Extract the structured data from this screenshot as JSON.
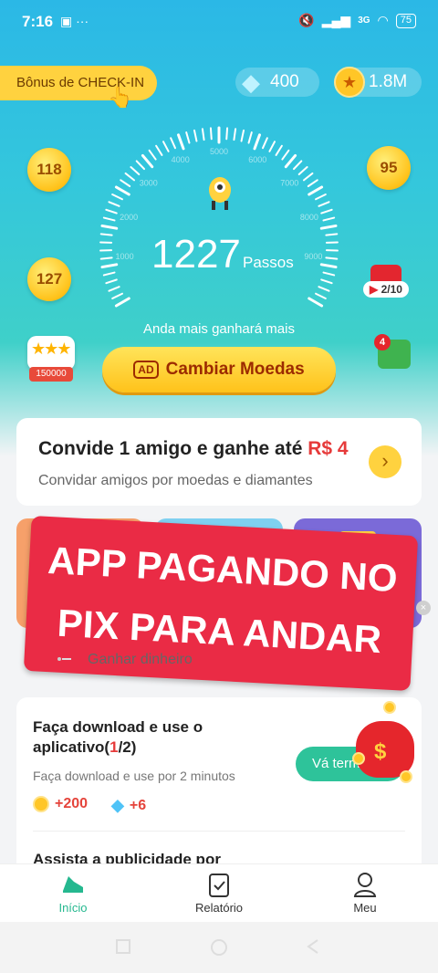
{
  "status_bar": {
    "time": "7:16",
    "left_icons": "▣ ···",
    "network": "3G",
    "battery": "75"
  },
  "header": {
    "checkin_label": "Bônus de CHECK-IN",
    "diamonds": "400",
    "coins": "1.8M"
  },
  "bubbles": {
    "top_left": "118",
    "bottom_left": "127",
    "top_right": "95"
  },
  "gauge": {
    "ticks": [
      "1000",
      "2000",
      "3000",
      "4000",
      "5000",
      "6000",
      "7000",
      "8000",
      "9000"
    ],
    "steps": "1227",
    "steps_unit": "Passos",
    "tagline": "Anda mais ganhará mais"
  },
  "gift": {
    "progress": "2/10"
  },
  "chest": {
    "label": "150000"
  },
  "money": {
    "badge": "4"
  },
  "exchange_button": {
    "ad_label": "AD",
    "label": "Cambiar Moedas"
  },
  "invite": {
    "title": "Convide 1 amigo e ganhe até ",
    "amount": "R$ 4",
    "subtitle": "Convidar amigos por moedas e diamantes",
    "arrow": "›"
  },
  "banner": {
    "line1": "APP PAGANDO NO",
    "line2": "PIX PARA ANDAR",
    "close": "×"
  },
  "earn_text": "Ganhar dinheiro",
  "task": {
    "title": "Faça download e use o aplicativo(",
    "progress": "1",
    "progress_suffix": "/2)",
    "subtitle": "Faça download e use por 2 minutos",
    "reward_coins": "+200",
    "reward_diamonds": "+6",
    "button": "Vá terminar",
    "next_title": "Assista a publicidade por"
  },
  "bottom_nav": {
    "home": "Início",
    "report": "Relatório",
    "me": "Meu"
  },
  "colors": {
    "accent_green": "#25b88f",
    "banner_red": "#ea2b45",
    "gold": "#ffc21a"
  }
}
